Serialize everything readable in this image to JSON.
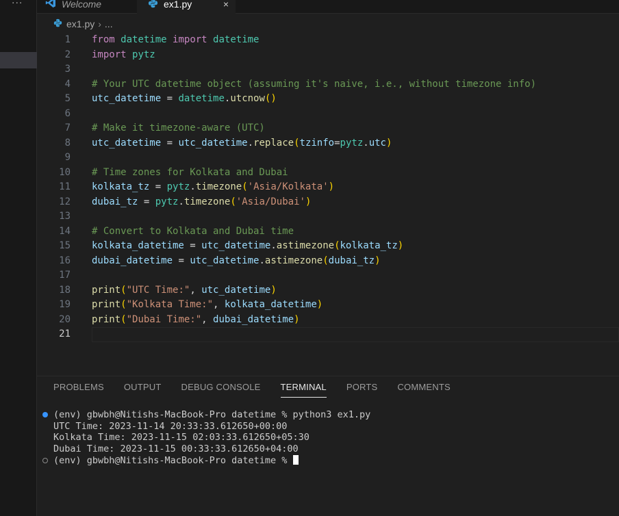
{
  "sidebar": {
    "more_label": "..."
  },
  "tabs": [
    {
      "label": "Welcome",
      "icon": "vscode-logo-icon"
    },
    {
      "label": "ex1.py",
      "icon": "python-icon",
      "close": "×"
    }
  ],
  "breadcrumb": {
    "file": "ex1.py",
    "separator": "›",
    "rest": "..."
  },
  "editor": {
    "language": "python",
    "current_line": 21,
    "lines": [
      {
        "n": "1",
        "text": "from datetime import datetime"
      },
      {
        "n": "2",
        "text": "import pytz"
      },
      {
        "n": "3",
        "text": ""
      },
      {
        "n": "4",
        "text": "# Your UTC datetime object (assuming it's naive, i.e., without timezone info)"
      },
      {
        "n": "5",
        "text": "utc_datetime = datetime.utcnow()"
      },
      {
        "n": "6",
        "text": ""
      },
      {
        "n": "7",
        "text": "# Make it timezone-aware (UTC)"
      },
      {
        "n": "8",
        "text": "utc_datetime = utc_datetime.replace(tzinfo=pytz.utc)"
      },
      {
        "n": "9",
        "text": ""
      },
      {
        "n": "10",
        "text": "# Time zones for Kolkata and Dubai"
      },
      {
        "n": "11",
        "text": "kolkata_tz = pytz.timezone('Asia/Kolkata')"
      },
      {
        "n": "12",
        "text": "dubai_tz = pytz.timezone('Asia/Dubai')"
      },
      {
        "n": "13",
        "text": ""
      },
      {
        "n": "14",
        "text": "# Convert to Kolkata and Dubai time"
      },
      {
        "n": "15",
        "text": "kolkata_datetime = utc_datetime.astimezone(kolkata_tz)"
      },
      {
        "n": "16",
        "text": "dubai_datetime = utc_datetime.astimezone(dubai_tz)"
      },
      {
        "n": "17",
        "text": ""
      },
      {
        "n": "18",
        "text": "print(\"UTC Time:\", utc_datetime)"
      },
      {
        "n": "19",
        "text": "print(\"Kolkata Time:\", kolkata_datetime)"
      },
      {
        "n": "20",
        "text": "print(\"Dubai Time:\", dubai_datetime)"
      },
      {
        "n": "21",
        "text": ""
      }
    ]
  },
  "panel": {
    "tabs": [
      "PROBLEMS",
      "OUTPUT",
      "DEBUG CONSOLE",
      "TERMINAL",
      "PORTS",
      "COMMENTS"
    ],
    "active_tab": "TERMINAL"
  },
  "terminal": {
    "lines": [
      {
        "text": "(env) gbwbh@Nitishs-MacBook-Pro datetime % python3 ex1.py",
        "deco": "success"
      },
      {
        "text": "UTC Time: 2023-11-14 20:33:33.612650+00:00",
        "deco": "none"
      },
      {
        "text": "Kolkata Time: 2023-11-15 02:03:33.612650+05:30",
        "deco": "none"
      },
      {
        "text": "Dubai Time: 2023-11-15 00:33:33.612650+04:00",
        "deco": "none"
      },
      {
        "text": "(env) gbwbh@Nitishs-MacBook-Pro datetime % ",
        "deco": "empty",
        "cursor": true
      }
    ]
  },
  "colors": {
    "accent": "#0078d4",
    "keyword": "#c586c0",
    "module": "#4ec9b0",
    "variable": "#9cdcfe",
    "function": "#dcdcaa",
    "string": "#ce9178",
    "comment": "#6a9955",
    "success_dot": "#3794ff"
  }
}
